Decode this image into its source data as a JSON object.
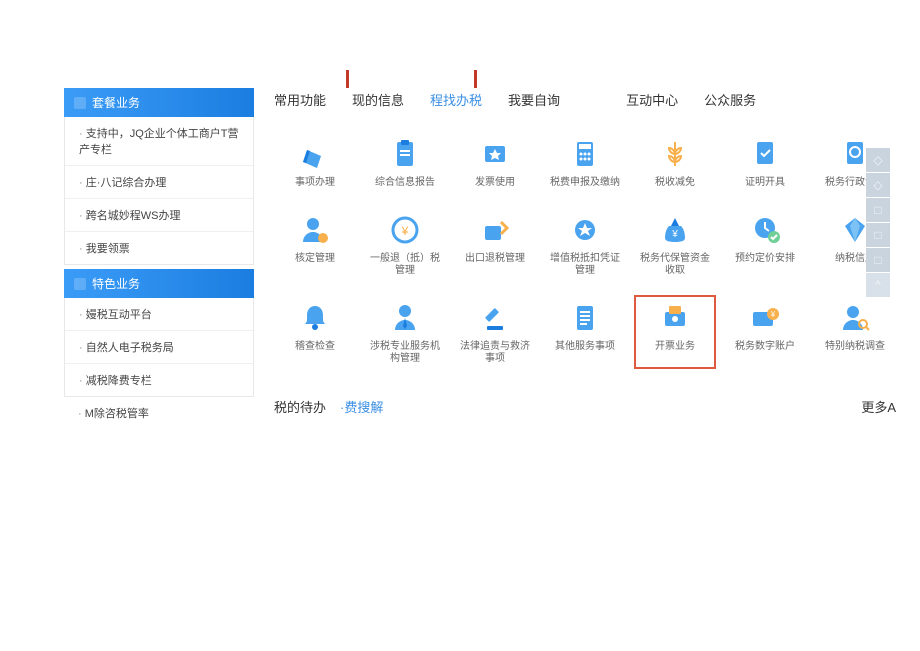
{
  "sidebar": {
    "panel1": {
      "title": "套餐业务",
      "items": [
        "支持中，JQ企业个体工商户T营产专栏",
        "庄·八记综合办理",
        "跨名城妙程WS办理",
        "我要领票"
      ]
    },
    "panel2": {
      "title": "特色业务",
      "items": [
        "嫚税互动平台",
        "自然人电子税务局",
        "减税降费专栏"
      ]
    },
    "extra": "M除咨税管率"
  },
  "tabs": [
    "常用功能",
    "现的信息",
    "程找办税",
    "我要自询",
    "互动中心",
    "公众服务"
  ],
  "active_tab_index": 2,
  "icons": {
    "colors": {
      "primary": "#4aa3ef",
      "accent": "#f7b04c",
      "dark": "#1b7de0"
    }
  },
  "grid": [
    {
      "label": "事项办理",
      "icon": "pencil"
    },
    {
      "label": "综合信息报告",
      "icon": "clipboard"
    },
    {
      "label": "发票使用",
      "icon": "ticket-star"
    },
    {
      "label": "税费申报及缴纳",
      "icon": "calculator"
    },
    {
      "label": "税收减免",
      "icon": "wheat"
    },
    {
      "label": "证明开具",
      "icon": "doc-check"
    },
    {
      "label": "税务行政许可",
      "icon": "doc-stamp"
    },
    {
      "label": "核定管理",
      "icon": "user-gear"
    },
    {
      "label": "一般退（抵）税管理",
      "icon": "refund"
    },
    {
      "label": "出口退税管理",
      "icon": "export"
    },
    {
      "label": "增值税抵扣凭证管理",
      "icon": "badge-doc"
    },
    {
      "label": "税务代保管资金收取",
      "icon": "money-bag"
    },
    {
      "label": "预约定价安排",
      "icon": "time-check"
    },
    {
      "label": "纳税信用",
      "icon": "diamond"
    },
    {
      "label": "稽查检查",
      "icon": "bell"
    },
    {
      "label": "涉税专业服务机构管理",
      "icon": "user-tie"
    },
    {
      "label": "法律追责与救济事项",
      "icon": "gavel"
    },
    {
      "label": "其他服务事项",
      "icon": "doc-lines"
    },
    {
      "label": "开票业务",
      "icon": "invoice-machine",
      "highlight": true
    },
    {
      "label": "税务数字账户",
      "icon": "card-coin"
    },
    {
      "label": "特别纳税调查",
      "icon": "user-search"
    }
  ],
  "bottom": {
    "left1": "税的待办",
    "left2": "·费搜解",
    "right": "更多A"
  },
  "toolbar": [
    "◇",
    "◇",
    "□",
    "□",
    "□",
    "^"
  ]
}
